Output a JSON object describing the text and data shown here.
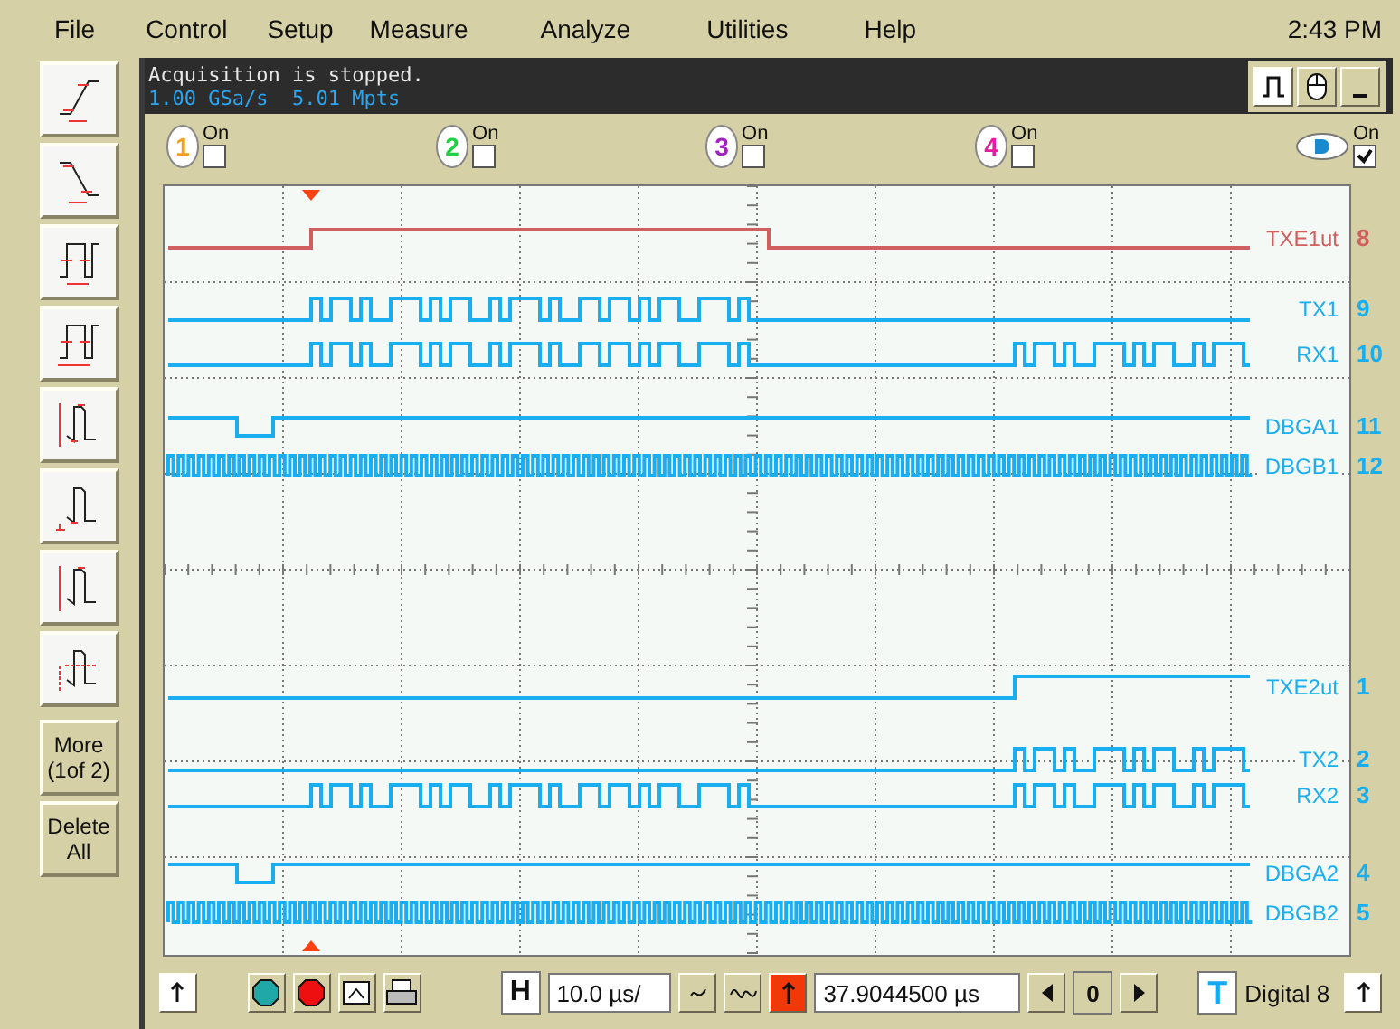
{
  "menu": [
    {
      "label": "File"
    },
    {
      "label": "Control"
    },
    {
      "label": "Setup"
    },
    {
      "label": "Measure"
    },
    {
      "label": "Analyze"
    },
    {
      "label": "Utilities"
    },
    {
      "label": "Help"
    }
  ],
  "clock": "2:43 PM",
  "status": {
    "message": "Acquisition is stopped.",
    "sample_rate": "1.00 GSa/s",
    "memory_depth": "5.01 Mpts"
  },
  "channels": [
    {
      "number": "1",
      "label": "On",
      "checked": false,
      "color": "#f0a020"
    },
    {
      "number": "2",
      "label": "On",
      "checked": false,
      "color": "#20d040"
    },
    {
      "number": "3",
      "label": "On",
      "checked": false,
      "color": "#a020c0"
    },
    {
      "number": "4",
      "label": "On",
      "checked": false,
      "color": "#e020a0"
    }
  ],
  "digital": {
    "label": "On",
    "checked": true
  },
  "left_toolbar": {
    "more": "More (1of 2)",
    "delete": "Delete All"
  },
  "traces": [
    {
      "name": "TXE1ut",
      "number": "8",
      "kind": "enable",
      "color": "#d06060"
    },
    {
      "name": "TX1",
      "number": "9",
      "kind": "burst",
      "color": "#18aef0"
    },
    {
      "name": "RX1",
      "number": "10",
      "kind": "burstboth",
      "color": "#18aef0"
    },
    {
      "name": "DBGA1",
      "number": "11",
      "kind": "strobe",
      "color": "#18aef0"
    },
    {
      "name": "DBGB1",
      "number": "12",
      "kind": "clock",
      "color": "#18aef0"
    },
    {
      "name": "TXE2ut",
      "number": "1",
      "kind": "enablelate",
      "color": "#18aef0"
    },
    {
      "name": "TX2",
      "number": "2",
      "kind": "burstlate",
      "color": "#18aef0"
    },
    {
      "name": "RX2",
      "number": "3",
      "kind": "burstboth",
      "color": "#18aef0"
    },
    {
      "name": "DBGA2",
      "number": "4",
      "kind": "strobe",
      "color": "#18aef0"
    },
    {
      "name": "DBGB2",
      "number": "5",
      "kind": "clock",
      "color": "#18aef0"
    }
  ],
  "bottom": {
    "horizontal_button": "H",
    "time_scale": "10.0 µs/",
    "delay": "37.9044500 µs",
    "delay_zero": "0",
    "trigger_button": "T",
    "trigger_source": "Digital 8"
  }
}
